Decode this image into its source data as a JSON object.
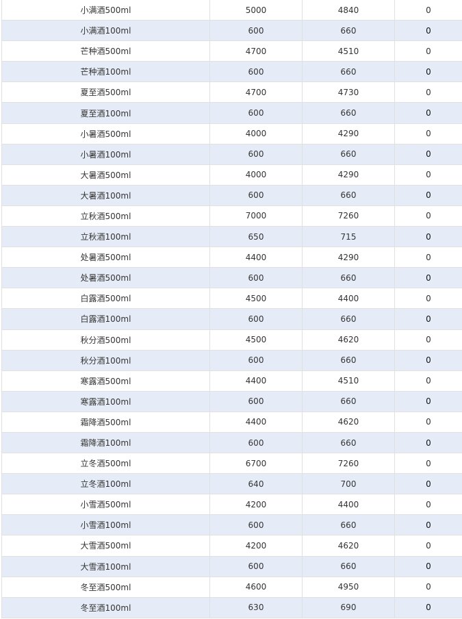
{
  "table": {
    "rows": [
      [
        "小满酒500ml",
        "5000",
        "4840",
        "0"
      ],
      [
        "小满酒100ml",
        "600",
        "660",
        "0"
      ],
      [
        "芒种酒500ml",
        "4700",
        "4510",
        "0"
      ],
      [
        "芒种酒100ml",
        "600",
        "660",
        "0"
      ],
      [
        "夏至酒500ml",
        "4700",
        "4730",
        "0"
      ],
      [
        "夏至酒100ml",
        "600",
        "660",
        "0"
      ],
      [
        "小暑酒500ml",
        "4000",
        "4290",
        "0"
      ],
      [
        "小暑酒100ml",
        "600",
        "660",
        "0"
      ],
      [
        "大暑酒500ml",
        "4000",
        "4290",
        "0"
      ],
      [
        "大暑酒100ml",
        "600",
        "660",
        "0"
      ],
      [
        "立秋酒500ml",
        "7000",
        "7260",
        "0"
      ],
      [
        "立秋酒100ml",
        "650",
        "715",
        "0"
      ],
      [
        "处暑酒500ml",
        "4400",
        "4290",
        "0"
      ],
      [
        "处暑酒500ml",
        "600",
        "660",
        "0"
      ],
      [
        "白露酒500ml",
        "4500",
        "4400",
        "0"
      ],
      [
        "白露酒100ml",
        "600",
        "660",
        "0"
      ],
      [
        "秋分酒500ml",
        "4500",
        "4620",
        "0"
      ],
      [
        "秋分酒100ml",
        "600",
        "660",
        "0"
      ],
      [
        "寒露酒500ml",
        "4400",
        "4510",
        "0"
      ],
      [
        "寒露酒100ml",
        "600",
        "660",
        "0"
      ],
      [
        "霜降酒500ml",
        "4400",
        "4620",
        "0"
      ],
      [
        "霜降酒100ml",
        "600",
        "660",
        "0"
      ],
      [
        "立冬酒500ml",
        "6700",
        "7260",
        "0"
      ],
      [
        "立冬酒100ml",
        "640",
        "700",
        "0"
      ],
      [
        "小雪酒500ml",
        "4200",
        "4400",
        "0"
      ],
      [
        "小雪酒100ml",
        "600",
        "660",
        "0"
      ],
      [
        "大雪酒500ml",
        "4200",
        "4620",
        "0"
      ],
      [
        "大雪酒100ml",
        "600",
        "660",
        "0"
      ],
      [
        "冬至酒500ml",
        "4600",
        "4950",
        "0"
      ],
      [
        "冬至酒100ml",
        "630",
        "690",
        "0"
      ]
    ]
  }
}
